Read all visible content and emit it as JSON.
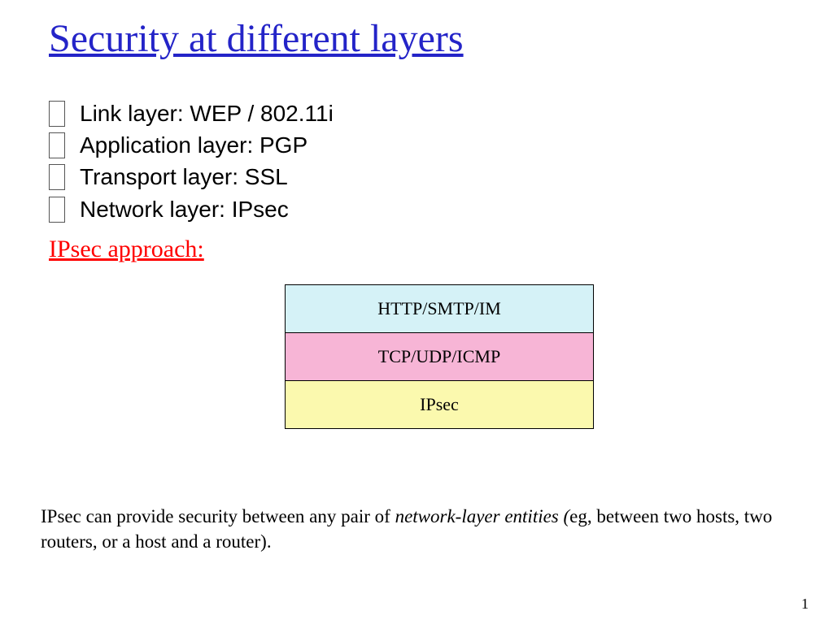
{
  "title": "Security at different layers",
  "bullets": [
    "Link layer: WEP / 802.11i",
    "Application layer: PGP",
    "Transport layer: SSL",
    "Network layer: IPsec"
  ],
  "subhead": "IPsec approach:",
  "stack": {
    "app": "HTTP/SMTP/IM",
    "tran": "TCP/UDP/ICMP",
    "net": "IPsec"
  },
  "footnote_plain": "IPsec can provide security between any pair of ",
  "footnote_em": "network-layer entities (",
  "footnote_tail": "eg, between two hosts, two routers, or a host and a router).",
  "pagenum": "1"
}
